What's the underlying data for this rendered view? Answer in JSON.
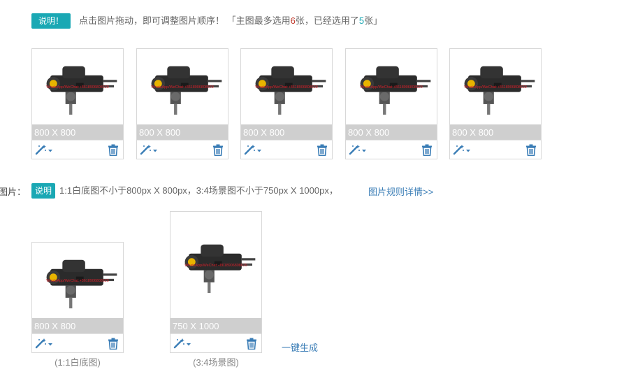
{
  "main_images": {
    "notice_badge": "说明！",
    "notice_text_before": "点击图片拖动，即可调整图片顺序！ 「主图最多选用",
    "max_count": "6",
    "notice_text_middle": "张，已经选用了",
    "used_count": "5",
    "notice_text_after": "张」",
    "items": [
      {
        "size": "800 X 800"
      },
      {
        "size": "800 X 800"
      },
      {
        "size": "800 X 800"
      },
      {
        "size": "800 X 800"
      },
      {
        "size": "800 X 800"
      }
    ]
  },
  "side_images": {
    "row_label": "图片：",
    "notice_badge": "说明",
    "notice_text": "1:1白底图不小于800px X 800px，3:4场景图不小于750px X 1000px，",
    "rules_link": "图片规则详情>>",
    "items": [
      {
        "size": "800 X 800",
        "caption": "(1:1白底图)"
      },
      {
        "size": "750 X 1000",
        "caption": "(3:4场景图)"
      }
    ],
    "generate_link": "一键生成"
  },
  "icons": {
    "edit": "magic-wand-icon",
    "delete": "trash-icon"
  },
  "colors": {
    "accent": "#1aa8b4",
    "link": "#3a7db6",
    "icon": "#3a7db6",
    "size_bar": "#cfcfcf"
  }
}
